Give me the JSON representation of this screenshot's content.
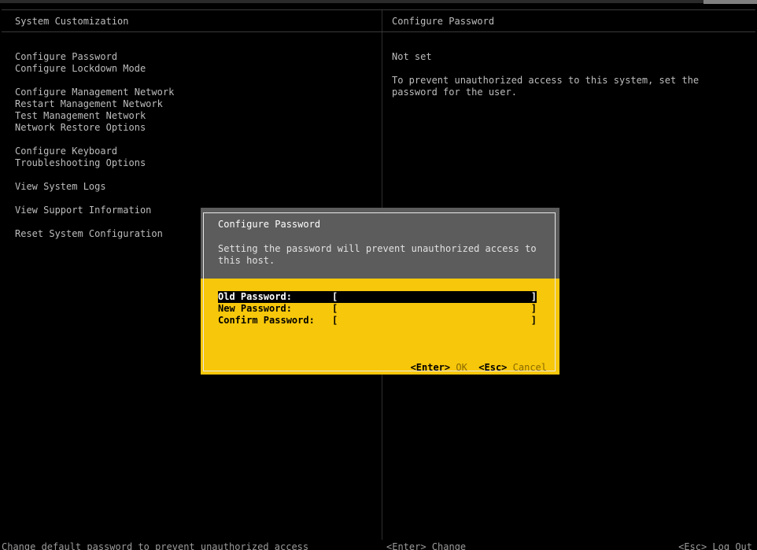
{
  "header": {
    "left_title": "System Customization",
    "right_title": "Configure Password"
  },
  "menu": {
    "items": [
      {
        "label": "Configure Password"
      },
      {
        "label": "Configure Lockdown Mode"
      },
      {
        "label": "Configure Management Network"
      },
      {
        "label": "Restart Management Network"
      },
      {
        "label": "Test Management Network"
      },
      {
        "label": "Network Restore Options"
      },
      {
        "label": "Configure Keyboard"
      },
      {
        "label": "Troubleshooting Options"
      },
      {
        "label": "View System Logs"
      },
      {
        "label": "View Support Information"
      },
      {
        "label": "Reset System Configuration"
      }
    ]
  },
  "detail": {
    "status": "Not set",
    "description": "To prevent unauthorized access to this system, set the password for the user."
  },
  "dialog": {
    "title": "Configure Password",
    "message": "Setting the password will prevent unauthorized access to this host.",
    "fields": [
      {
        "label": "Old Password:",
        "value": ""
      },
      {
        "label": "New Password:",
        "value": ""
      },
      {
        "label": "Confirm Password:",
        "value": ""
      }
    ],
    "ok_key": "<Enter>",
    "ok_label": "OK",
    "cancel_key": "<Esc>",
    "cancel_label": "Cancel"
  },
  "footer": {
    "hint": "Change default password to prevent unauthorized access",
    "enter_hint": "<Enter> Change",
    "esc_hint": "<Esc> Log Out"
  },
  "colors": {
    "background": "#000000",
    "dialog_header": "#5c5c5c",
    "dialog_body": "#f7c70b",
    "text": "#bdbdbd"
  }
}
